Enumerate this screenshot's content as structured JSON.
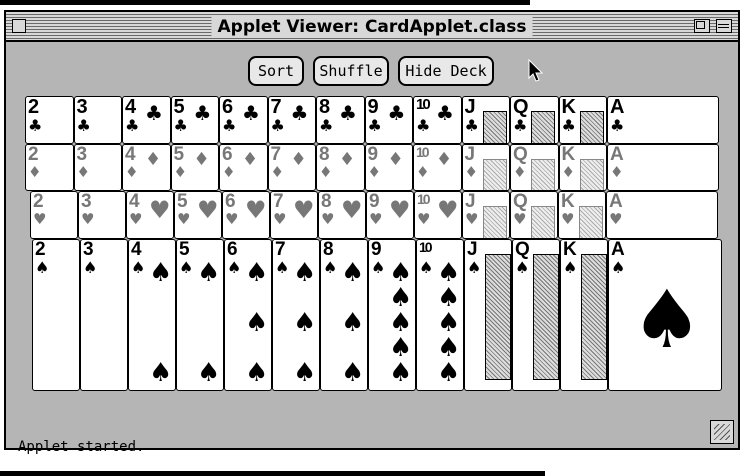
{
  "window": {
    "title": "Applet Viewer: CardApplet.class"
  },
  "buttons": {
    "sort": "Sort",
    "shuffle": "Shuffle",
    "hide_deck": "Hide Deck"
  },
  "status": "Applet started.",
  "rows": [
    {
      "suit": "clubs",
      "symbol": "♣",
      "ranks": [
        "2",
        "3",
        "4",
        "5",
        "6",
        "7",
        "8",
        "9",
        "10",
        "J",
        "Q",
        "K",
        "A"
      ]
    },
    {
      "suit": "diamonds",
      "symbol": "♦",
      "ranks": [
        "2",
        "3",
        "4",
        "5",
        "6",
        "7",
        "8",
        "9",
        "10",
        "J",
        "Q",
        "K",
        "A"
      ]
    },
    {
      "suit": "hearts",
      "symbol": "♥",
      "ranks": [
        "2",
        "3",
        "4",
        "5",
        "6",
        "7",
        "8",
        "9",
        "10",
        "J",
        "Q",
        "K",
        "A"
      ]
    },
    {
      "suit": "spades",
      "symbol": "♠",
      "ranks": [
        "2",
        "3",
        "4",
        "5",
        "6",
        "7",
        "8",
        "9",
        "10",
        "J",
        "Q",
        "K",
        "A"
      ]
    }
  ],
  "colors": {
    "window_bg": "#b5b5b5",
    "card_bg": "#ffffff",
    "ink": "#000000"
  }
}
